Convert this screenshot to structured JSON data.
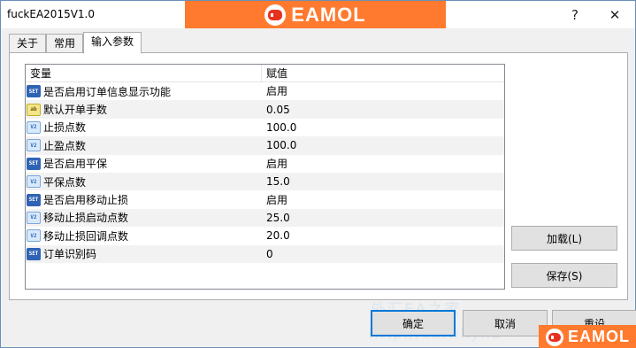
{
  "window": {
    "title": "fuckEA2015V1.0",
    "help_label": "?",
    "close_label": "✕"
  },
  "banner": {
    "logo_text": "EAMOL",
    "brand_color": "#ff7a2e"
  },
  "tabs": [
    {
      "label": "关于"
    },
    {
      "label": "常用"
    },
    {
      "label": "输入参数",
      "active": true
    }
  ],
  "grid": {
    "headers": {
      "variable": "变量",
      "value": "赋值"
    },
    "rows": [
      {
        "icon": "enum-type-icon",
        "name": "是否启用订单信息显示功能",
        "value": "启用"
      },
      {
        "icon": "string-type-icon",
        "name": "默认开单手数",
        "value": "0.05"
      },
      {
        "icon": "double-type-icon",
        "name": "止损点数",
        "value": "100.0"
      },
      {
        "icon": "double-type-icon",
        "name": "止盈点数",
        "value": "100.0"
      },
      {
        "icon": "enum-type-icon",
        "name": "是否启用平保",
        "value": "启用"
      },
      {
        "icon": "double-type-icon",
        "name": "平保点数",
        "value": "15.0"
      },
      {
        "icon": "enum-type-icon",
        "name": "是否启用移动止损",
        "value": "启用"
      },
      {
        "icon": "double-type-icon",
        "name": "移动止损启动点数",
        "value": "25.0"
      },
      {
        "icon": "double-type-icon",
        "name": "移动止损回调点数",
        "value": "20.0"
      },
      {
        "icon": "enum-type-icon",
        "name": "订单识别码",
        "value": "0"
      }
    ]
  },
  "buttons": {
    "load": "加载(L)",
    "save": "保存(S)",
    "ok": "确定",
    "cancel": "取消",
    "reset": "重设"
  },
  "watermark": {
    "text": "外汇EA之家",
    "url": "http://ea.whyhu"
  },
  "corner_logo": {
    "text": "EAMOL"
  }
}
